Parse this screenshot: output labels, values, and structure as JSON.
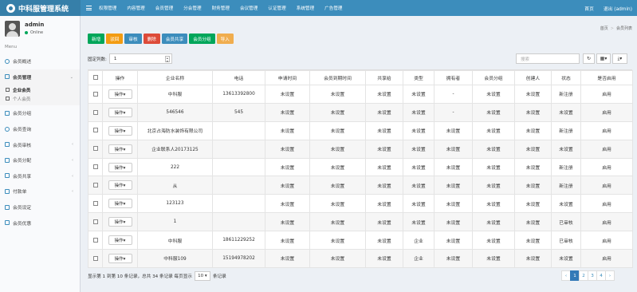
{
  "app": {
    "title": "中科服管理系统"
  },
  "topnav": [
    "权限管理",
    "内容管理",
    "会员管理",
    "分会管理",
    "财务管理",
    "会议管理",
    "认证管理",
    "系统管理",
    "广告管理"
  ],
  "topright": {
    "home": "首页",
    "logout": "退出 (admin)"
  },
  "user": {
    "name": "admin",
    "status": "Online"
  },
  "menu_header": "Menu",
  "menu": {
    "overview": "会员概述",
    "manage": "会员管理",
    "sub_enterprise": "企业会员",
    "sub_personal": "个人会员",
    "group": "会员分组",
    "query": "会员查询",
    "audit": "会员审核",
    "assign": "会员分配",
    "share": "会员共享",
    "payment": "付款单",
    "settings": "会员设定",
    "benefits": "会员优惠"
  },
  "breadcrumb": {
    "home": "首页",
    "current": "会员列表"
  },
  "toolbar": {
    "add": "新增",
    "back": "驳回",
    "audit": "审核",
    "delete": "删除",
    "share": "会员共享",
    "group": "会员分组",
    "import": "导入"
  },
  "frozen": {
    "label": "固定列数:",
    "value": "1"
  },
  "search": {
    "placeholder": "搜索"
  },
  "icons": {
    "refresh": "↻",
    "columns": "▦▾",
    "export": "⤓▾"
  },
  "table": {
    "columns": [
      "操作",
      "企业名称",
      "电话",
      "申请时间",
      "会员到期时间",
      "共享给",
      "类型",
      "拥有者",
      "会员分组",
      "创建人",
      "状态",
      "是否启用"
    ],
    "op_label": "操作▾",
    "rows": [
      [
        "中科服",
        "13613392800",
        "未设置",
        "未设置",
        "未设置",
        "未设置",
        "-",
        "未设置",
        "未设置",
        "新注册",
        "启用"
      ],
      [
        "546546",
        "545",
        "未设置",
        "未设置",
        "未设置",
        "未设置",
        "-",
        "未设置",
        "未设置",
        "未设置",
        "启用"
      ],
      [
        "北京占海防水装饰有限公司",
        "",
        "未设置",
        "未设置",
        "未设置",
        "未设置",
        "未设置",
        "未设置",
        "未设置",
        "新注册",
        "启用"
      ],
      [
        "企业联系人20173125",
        "",
        "未设置",
        "未设置",
        "未设置",
        "未设置",
        "未设置",
        "未设置",
        "未设置",
        "未设置",
        "启用"
      ],
      [
        "222",
        "",
        "未设置",
        "未设置",
        "未设置",
        "未设置",
        "未设置",
        "未设置",
        "未设置",
        "新注册",
        "启用"
      ],
      [
        "从",
        "",
        "未设置",
        "未设置",
        "未设置",
        "未设置",
        "未设置",
        "未设置",
        "未设置",
        "新注册",
        "启用"
      ],
      [
        "123123",
        "",
        "未设置",
        "未设置",
        "未设置",
        "未设置",
        "未设置",
        "未设置",
        "未设置",
        "未设置",
        "启用"
      ],
      [
        "1",
        "",
        "未设置",
        "未设置",
        "未设置",
        "未设置",
        "未设置",
        "未设置",
        "未设置",
        "已审核",
        "启用"
      ],
      [
        "中科服",
        "18611229252",
        "未设置",
        "未设置",
        "未设置",
        "企业",
        "未设置",
        "未设置",
        "未设置",
        "已审核",
        "启用"
      ],
      [
        "中科服109",
        "15194978202",
        "未设置",
        "未设置",
        "未设置",
        "企业",
        "未设置",
        "未设置",
        "未设置",
        "未设置",
        "启用"
      ]
    ]
  },
  "footer": {
    "prefix": "显示第 1 到第 10 条记录，总共 34 条记录 每页显示",
    "page_size": "10 ▾",
    "suffix": "条记录"
  },
  "pager": [
    "‹",
    "1",
    "2",
    "3",
    "4",
    "›"
  ],
  "colors": {
    "topbar": "#3c8dbc",
    "logo_bg": "#367fa9",
    "primary": "#337ab7"
  }
}
